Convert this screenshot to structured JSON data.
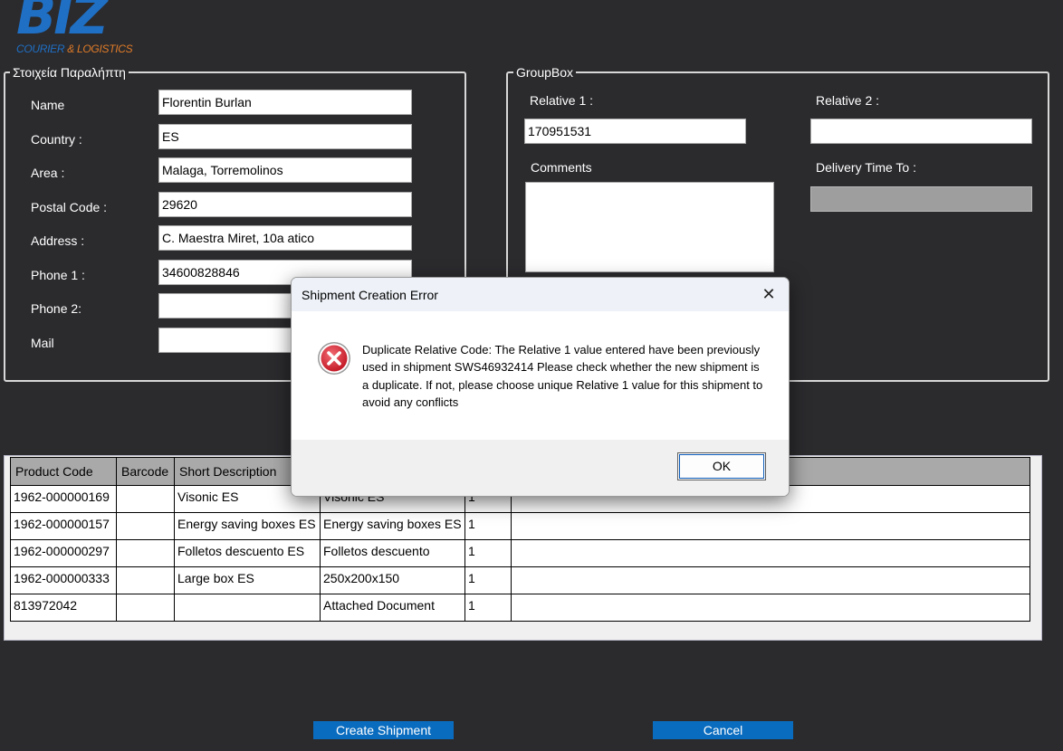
{
  "logo": {
    "brand": "BIZ",
    "tagline_main": "COURIER ",
    "tagline_amp": "& LOGISTICS"
  },
  "recipient": {
    "title": "Στοιχεία Παραλήπτη",
    "fields": [
      {
        "label": "Name",
        "value": "Florentin Burlan"
      },
      {
        "label": "Country :",
        "value": "ES"
      },
      {
        "label": "Area :",
        "value": "Malaga, Torremolinos"
      },
      {
        "label": "Postal Code :",
        "value": "29620"
      },
      {
        "label": "Address :",
        "value": "C. Maestra Miret, 10a atico"
      },
      {
        "label": "Phone 1 :",
        "value": "34600828846"
      },
      {
        "label": "Phone 2:",
        "value": ""
      },
      {
        "label": "Mail",
        "value": ""
      }
    ]
  },
  "groupbox": {
    "title": "GroupBox",
    "relative1_label": "Relative 1 :",
    "relative1_value": "170951531",
    "relative2_label": "Relative 2 :",
    "relative2_value": "",
    "comments_label": "Comments",
    "delivery_label": "Delivery Time To :"
  },
  "table": {
    "headers": [
      "Product Code",
      "Barcode",
      "Short Description",
      "",
      "",
      ""
    ],
    "rows": [
      [
        "1962-000000169",
        "",
        "Visonic ES",
        "Visonic ES",
        "1",
        ""
      ],
      [
        "1962-000000157",
        "",
        "Energy saving boxes ES",
        "Energy saving boxes ES",
        "1",
        ""
      ],
      [
        "1962-000000297",
        "",
        "Folletos descuento ES",
        "Folletos descuento",
        "1",
        ""
      ],
      [
        "1962-000000333",
        "",
        "Large box ES",
        "250x200x150",
        "1",
        ""
      ],
      [
        "813972042",
        "",
        "",
        "Attached Document",
        "1",
        ""
      ]
    ]
  },
  "buttons": {
    "create": "Create Shipment",
    "cancel": "Cancel"
  },
  "dialog": {
    "title": "Shipment Creation Error",
    "close": "✕",
    "message": "Duplicate Relative Code: The Relative 1 value entered have been previously used in shipment SWS46932414 Please check whether the new shipment is a duplicate. If not, please choose unique Relative 1 value for this shipment to avoid any conflicts",
    "ok": "OK",
    "icon": "error-icon"
  },
  "colors": {
    "background": "#2b2b2e",
    "accent": "#0a6cbf",
    "error": "#d32f3a"
  }
}
